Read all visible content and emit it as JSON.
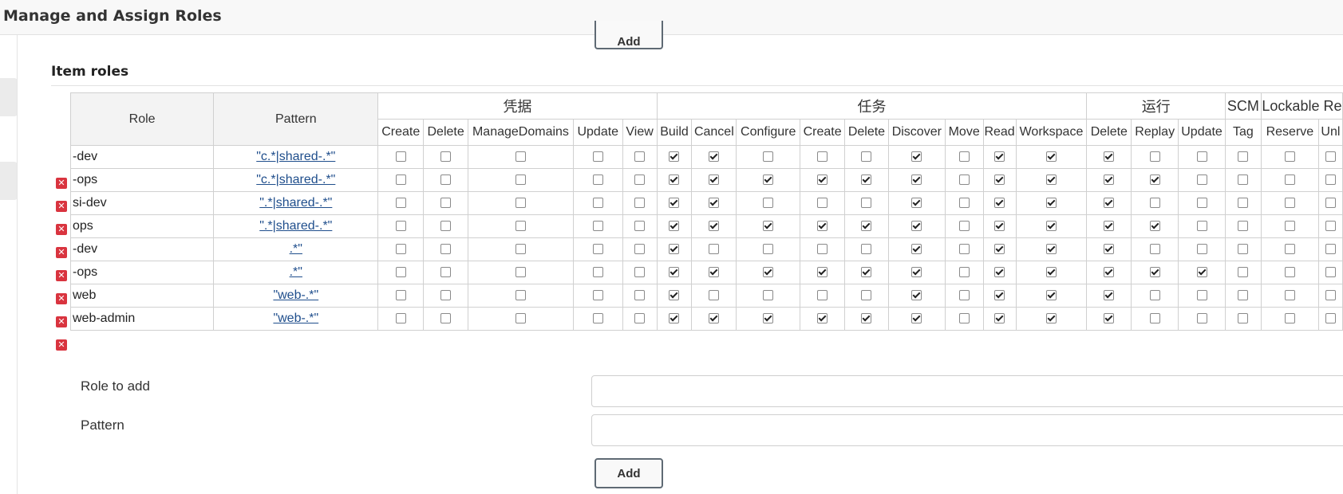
{
  "header": {
    "title": "Manage and Assign Roles"
  },
  "top_add_label": "Add",
  "section": {
    "title": "Item roles"
  },
  "table": {
    "col_role": "Role",
    "col_pattern": "Pattern",
    "groups": [
      {
        "label": "凭据",
        "perms": [
          "Create",
          "Delete",
          "ManageDomains",
          "Update",
          "View"
        ]
      },
      {
        "label": "任务",
        "perms": [
          "Build",
          "Cancel",
          "Configure",
          "Create",
          "Delete",
          "Discover",
          "Move",
          "Read",
          "Workspace"
        ]
      },
      {
        "label": "运行",
        "perms": [
          "Delete",
          "Replay",
          "Update"
        ]
      },
      {
        "label": "SCM",
        "perms": [
          "Tag"
        ]
      },
      {
        "label": "Lockable Re",
        "perms": [
          "Reserve",
          "Unl"
        ]
      }
    ],
    "rows": [
      {
        "role": "-dev",
        "pattern": "\"c.*|shared-.*\"",
        "checks": [
          0,
          0,
          0,
          0,
          0,
          1,
          1,
          0,
          0,
          0,
          1,
          0,
          1,
          1,
          1,
          0,
          0,
          0,
          0,
          0
        ]
      },
      {
        "role": "-ops",
        "pattern": "\"c.*|shared-.*\"",
        "checks": [
          0,
          0,
          0,
          0,
          0,
          1,
          1,
          1,
          1,
          1,
          1,
          0,
          1,
          1,
          1,
          1,
          0,
          0,
          0,
          0
        ]
      },
      {
        "role": "si-dev",
        "pattern": "\".*|shared-.*\"",
        "checks": [
          0,
          0,
          0,
          0,
          0,
          1,
          1,
          0,
          0,
          0,
          1,
          0,
          1,
          1,
          1,
          0,
          0,
          0,
          0,
          0
        ]
      },
      {
        "role": "ops",
        "pattern": "\".*|shared-.*\"",
        "checks": [
          0,
          0,
          0,
          0,
          0,
          1,
          1,
          1,
          1,
          1,
          1,
          0,
          1,
          1,
          1,
          1,
          0,
          0,
          0,
          0
        ]
      },
      {
        "role": "-dev",
        "pattern": ".*\"",
        "checks": [
          0,
          0,
          0,
          0,
          0,
          1,
          0,
          0,
          0,
          0,
          1,
          0,
          1,
          1,
          1,
          0,
          0,
          0,
          0,
          0
        ]
      },
      {
        "role": "-ops",
        "pattern": ".*\"",
        "checks": [
          0,
          0,
          0,
          0,
          0,
          1,
          1,
          1,
          1,
          1,
          1,
          0,
          1,
          1,
          1,
          1,
          1,
          0,
          0,
          0
        ]
      },
      {
        "role": "web",
        "pattern": "\"web-.*\"",
        "checks": [
          0,
          0,
          0,
          0,
          0,
          1,
          0,
          0,
          0,
          0,
          1,
          0,
          1,
          1,
          1,
          0,
          0,
          0,
          0,
          0
        ]
      },
      {
        "role": "web-admin",
        "pattern": "\"web-.*\"",
        "checks": [
          0,
          0,
          0,
          0,
          0,
          1,
          1,
          1,
          1,
          1,
          1,
          0,
          1,
          1,
          1,
          0,
          0,
          0,
          0,
          0
        ]
      }
    ]
  },
  "form": {
    "role_label": "Role to add",
    "pattern_label": "Pattern",
    "role_value": "",
    "pattern_value": "",
    "add_label": "Add"
  },
  "colors": {
    "delete_icon": "#d9343f",
    "link": "#1f4e8c",
    "header_bg": "#f8f8f8"
  }
}
